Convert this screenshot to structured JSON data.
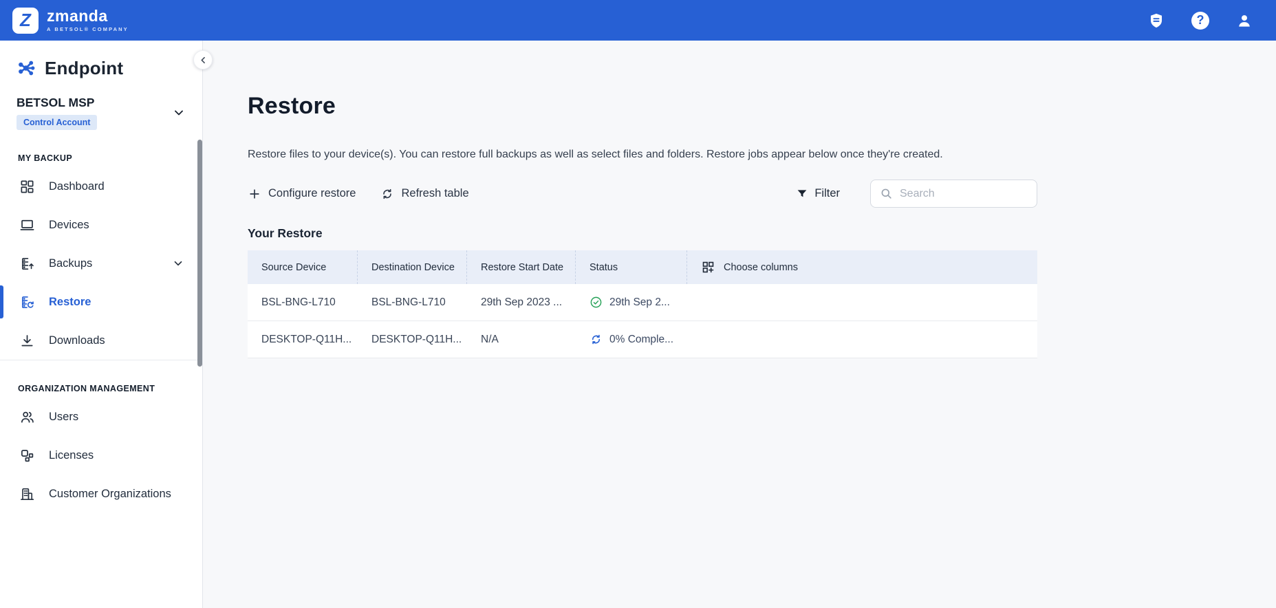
{
  "topbar": {
    "logo_letter": "Z",
    "brand": "zmanda",
    "tagline": "A BETSOL® COMPANY",
    "help_glyph": "?"
  },
  "sidebar": {
    "product": "Endpoint",
    "org_name": "BETSOL MSP",
    "org_badge": "Control Account",
    "sections": [
      {
        "label": "MY BACKUP",
        "items": [
          {
            "label": "Dashboard"
          },
          {
            "label": "Devices"
          },
          {
            "label": "Backups"
          },
          {
            "label": "Restore"
          },
          {
            "label": "Downloads"
          }
        ]
      },
      {
        "label": "ORGANIZATION MANAGEMENT",
        "items": [
          {
            "label": "Users"
          },
          {
            "label": "Licenses"
          },
          {
            "label": "Customer Organizations"
          }
        ]
      }
    ]
  },
  "main": {
    "title": "Restore",
    "description": "Restore files to your device(s). You can restore full backups as well as select files and folders. Restore jobs appear below once they're created.",
    "toolbar": {
      "configure": "Configure restore",
      "refresh": "Refresh table",
      "filter": "Filter",
      "search_placeholder": "Search"
    },
    "section_title": "Your Restore",
    "table": {
      "columns": {
        "source": "Source Device",
        "destination": "Destination Device",
        "start": "Restore Start Date",
        "status": "Status"
      },
      "choose_columns": "Choose columns",
      "rows": [
        {
          "source": "BSL-BNG-L710",
          "destination": "BSL-BNG-L710",
          "start": "29th Sep 2023 ...",
          "status": "29th Sep 2...",
          "status_kind": "success"
        },
        {
          "source": "DESKTOP-Q11H...",
          "destination": "DESKTOP-Q11H...",
          "start": "N/A",
          "status": "0% Comple...",
          "status_kind": "in-progress"
        }
      ]
    }
  },
  "icons": {
    "announcements-icon": "shield badge with text lines",
    "help-icon": "question mark in circle",
    "account-icon": "person silhouette",
    "endpoint-logo-icon": "blue hub-and-dots mark",
    "chevron-down-icon": "chevron down",
    "chevron-left-icon": "chevron left",
    "dashboard-icon": "grid of tiles",
    "devices-icon": "laptop",
    "backups-icon": "server with up arrow",
    "restore-icon": "server with rotate arrow",
    "downloads-icon": "down arrow into tray",
    "users-icon": "two people",
    "licenses-icon": "squares grid",
    "organizations-icon": "office building",
    "plus-icon": "plus",
    "refresh-icon": "two circular arrows",
    "filter-icon": "funnel",
    "search-icon": "magnifier",
    "choose-columns-icon": "grid with plus",
    "success-icon": "check in circle",
    "progress-icon": "spinner arrows"
  },
  "colors": {
    "topbar": "#2760d4",
    "accent": "#2760d4",
    "success": "#23a055",
    "table_header_bg": "#e9eef8",
    "page_bg": "#f7f8fa",
    "badge_bg": "#dde8f8"
  }
}
